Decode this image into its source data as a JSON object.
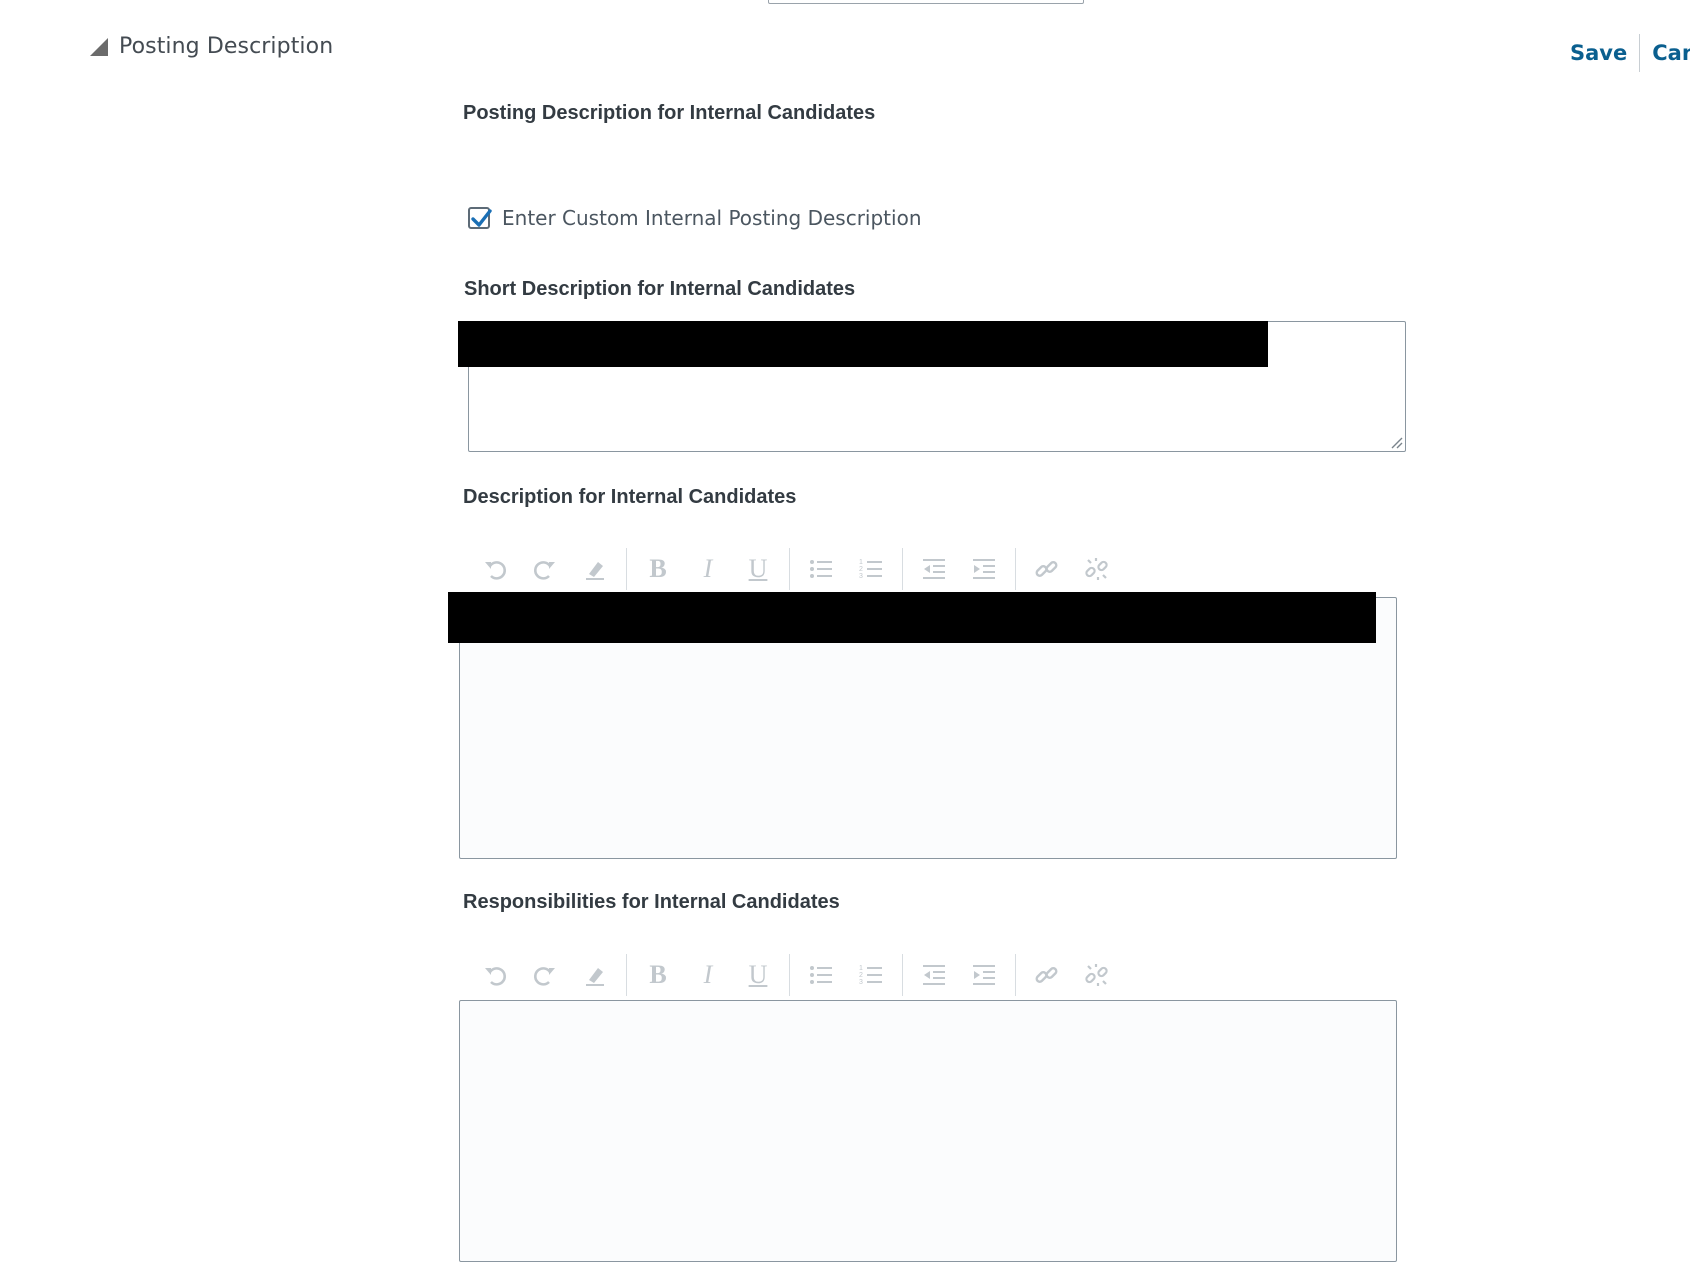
{
  "section": {
    "title": "Posting Description"
  },
  "actions": {
    "save": "Save",
    "cancel": "Canc"
  },
  "posting_heading": "Posting Description for Internal Candidates",
  "custom_checkbox": {
    "label": "Enter Custom Internal Posting Description",
    "checked": true
  },
  "short_description": {
    "label": "Short Description for Internal Candidates",
    "value": ""
  },
  "description": {
    "label": "Description for Internal Candidates"
  },
  "responsibilities": {
    "label": "Responsibilities for Internal Candidates"
  },
  "toolbar": {
    "buttons": [
      "undo-icon",
      "redo-icon",
      "eraser-icon",
      "bold-icon",
      "italic-icon",
      "underline-icon",
      "bulleted-list-icon",
      "numbered-list-icon",
      "outdent-icon",
      "indent-icon",
      "link-icon",
      "unlink-icon"
    ],
    "bold_glyph": "B",
    "italic_glyph": "I",
    "underline_glyph": "U"
  },
  "colors": {
    "accent": "#0a5f8f",
    "checkbox": "#1a6fb5",
    "disabled_icon": "#c2c8cd",
    "border": "#8a96a0"
  }
}
